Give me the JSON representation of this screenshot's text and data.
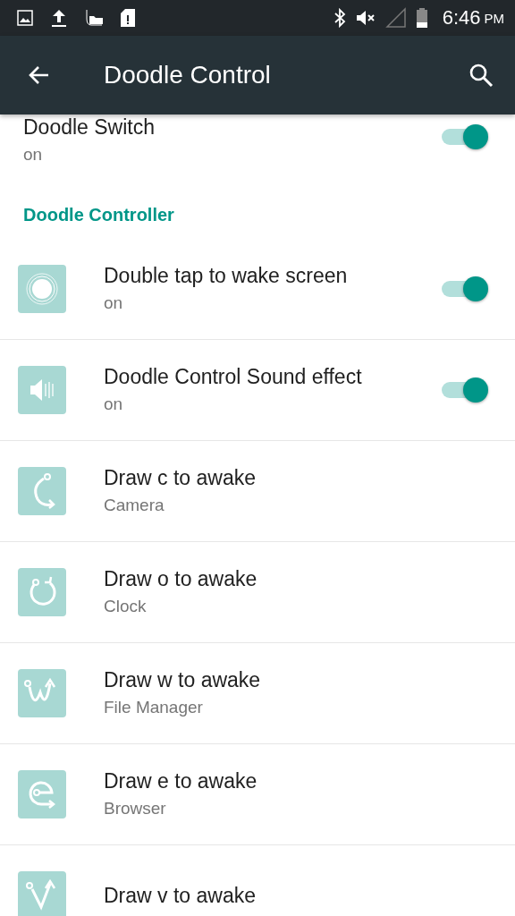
{
  "status_bar": {
    "time": "6:46",
    "ampm": "PM"
  },
  "app_bar": {
    "title": "Doodle Control"
  },
  "top_setting": {
    "title": "Doodle Switch",
    "summary": "on",
    "on": true
  },
  "section": {
    "title": "Doodle Controller"
  },
  "items": [
    {
      "kind": "switch",
      "title": "Double tap to wake screen",
      "summary": "on",
      "on": true
    },
    {
      "kind": "switch",
      "title": "Doodle Control Sound effect",
      "summary": "on",
      "on": true
    },
    {
      "kind": "gesture",
      "title": "Draw c to awake",
      "summary": "Camera"
    },
    {
      "kind": "gesture",
      "title": "Draw o to awake",
      "summary": "Clock"
    },
    {
      "kind": "gesture",
      "title": "Draw w to awake",
      "summary": "File Manager"
    },
    {
      "kind": "gesture",
      "title": "Draw e to awake",
      "summary": "Browser"
    },
    {
      "kind": "gesture",
      "title": "Draw v to awake"
    }
  ]
}
